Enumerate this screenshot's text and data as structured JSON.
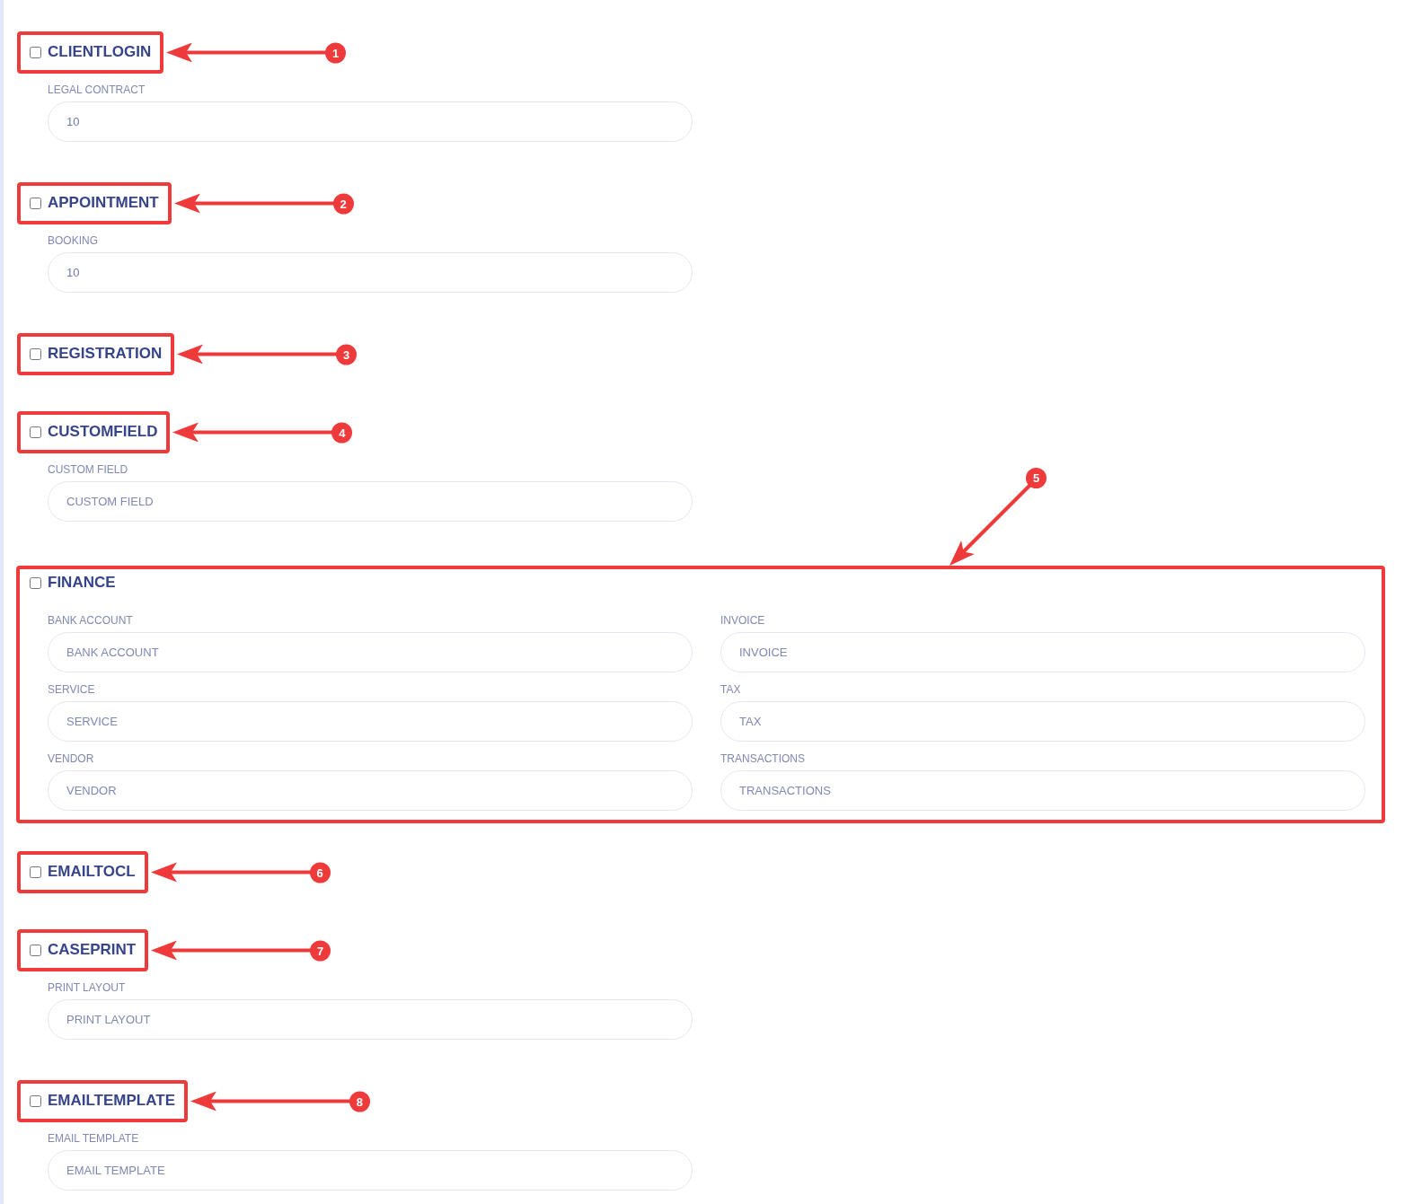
{
  "sections": [
    {
      "title": "CLIENTLOGIN",
      "checked": false,
      "callout": {
        "kind": "header",
        "number": "1"
      },
      "fields": [
        {
          "label": "LEGAL CONTRACT",
          "value": "10"
        }
      ]
    },
    {
      "title": "APPOINTMENT",
      "checked": false,
      "callout": {
        "kind": "header",
        "number": "2"
      },
      "fields": [
        {
          "label": "BOOKING",
          "value": "10"
        }
      ]
    },
    {
      "title": "REGISTRATION",
      "checked": false,
      "callout": {
        "kind": "header",
        "number": "3"
      }
    },
    {
      "title": "CUSTOMFIELD",
      "checked": false,
      "callout": {
        "kind": "header",
        "number": "4"
      },
      "fields": [
        {
          "label": "CUSTOM FIELD",
          "placeholder": "CUSTOM FIELD"
        }
      ]
    },
    {
      "title": "FINANCE",
      "checked": false,
      "callout": {
        "kind": "section",
        "number": "5"
      },
      "fields": [
        {
          "label": "BANK ACCOUNT",
          "placeholder": "BANK ACCOUNT"
        },
        {
          "label": "INVOICE",
          "placeholder": "INVOICE"
        },
        {
          "label": "SERVICE",
          "placeholder": "SERVICE"
        },
        {
          "label": "TAX",
          "placeholder": "TAX"
        },
        {
          "label": "VENDOR",
          "placeholder": "VENDOR"
        },
        {
          "label": "TRANSACTIONS",
          "placeholder": "TRANSACTIONS"
        }
      ]
    },
    {
      "title": "EMAILTOCL",
      "checked": false,
      "callout": {
        "kind": "header",
        "number": "6"
      }
    },
    {
      "title": "CASEPRINT",
      "checked": false,
      "callout": {
        "kind": "header",
        "number": "7"
      },
      "fields": [
        {
          "label": "PRINT LAYOUT",
          "placeholder": "PRINT LAYOUT"
        }
      ]
    },
    {
      "title": "EMAILTEMPLATE",
      "checked": false,
      "callout": {
        "kind": "header",
        "number": "8"
      },
      "fields": [
        {
          "label": "EMAIL TEMPLATE",
          "placeholder": "EMAIL TEMPLATE"
        }
      ]
    }
  ]
}
